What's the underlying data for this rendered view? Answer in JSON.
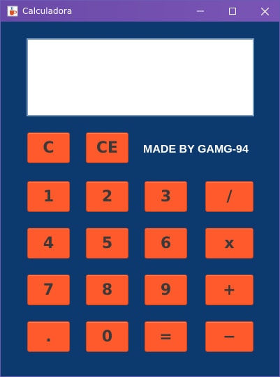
{
  "window": {
    "title": "Calculadora",
    "app_icon": "java-cup-icon",
    "controls": {
      "minimize_icon": "minimize-icon",
      "maximize_icon": "maximize-icon",
      "close_icon": "close-icon"
    }
  },
  "display": {
    "value": ""
  },
  "credit": "MADE BY GAMG-94",
  "keys": {
    "clear": "C",
    "clear_entry": "CE",
    "one": "1",
    "two": "2",
    "three": "3",
    "divide": "/",
    "four": "4",
    "five": "5",
    "six": "6",
    "multiply": "x",
    "seven": "7",
    "eight": "8",
    "nine": "9",
    "plus": "+",
    "dot": ".",
    "zero": "0",
    "equals": "=",
    "minus": "−"
  },
  "colors": {
    "background": "#0d3a6e",
    "key": "#fe5a2c",
    "key_text": "#3a3a3a",
    "titlebar": "#6a4aa8"
  }
}
